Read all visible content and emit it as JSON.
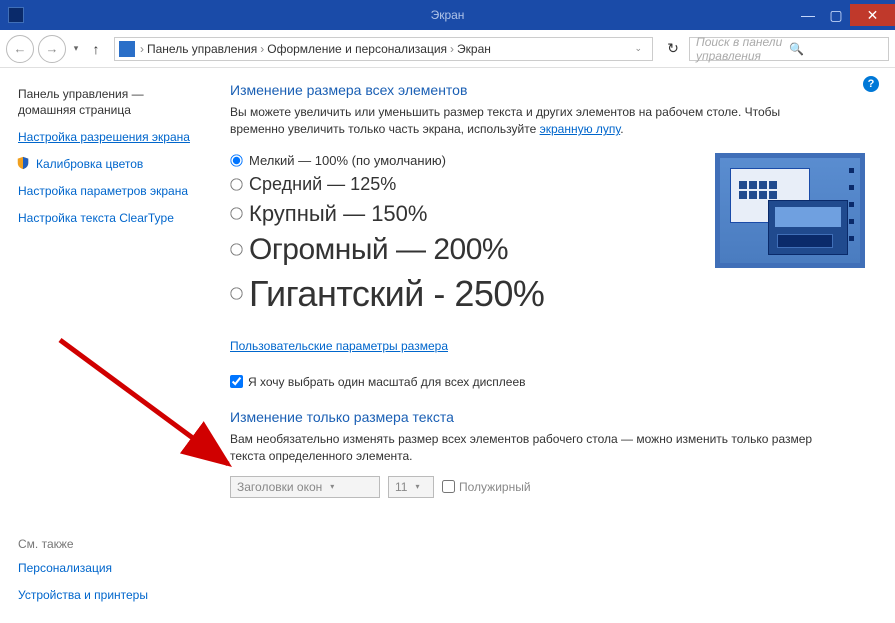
{
  "titlebar": {
    "title": "Экран"
  },
  "nav": {
    "breadcrumb": [
      "Панель управления",
      "Оформление и персонализация",
      "Экран"
    ],
    "search_placeholder": "Поиск в панели управления"
  },
  "sidebar": {
    "home_line1": "Панель управления —",
    "home_line2": "домашняя страница",
    "links": [
      "Настройка разрешения экрана",
      "Калибровка цветов",
      "Настройка параметров экрана",
      "Настройка текста ClearType"
    ],
    "see_also_title": "См. также",
    "see_also": [
      "Персонализация",
      "Устройства и принтеры"
    ]
  },
  "main": {
    "section1": {
      "heading": "Изменение размера всех элементов",
      "desc_before": "Вы можете увеличить или уменьшить размер текста и других элементов на рабочем столе. Чтобы временно увеличить только часть экрана, используйте ",
      "desc_link": "экранную лупу",
      "desc_after": "."
    },
    "radios": [
      {
        "label": "Мелкий — 100% (по умолчанию)",
        "checked": true,
        "class": "r-small"
      },
      {
        "label": "Средний — 125%",
        "checked": false,
        "class": "r-medium"
      },
      {
        "label": "Крупный — 150%",
        "checked": false,
        "class": "r-large"
      },
      {
        "label": "Огромный — 200%",
        "checked": false,
        "class": "r-huge"
      },
      {
        "label": "Гигантский - 250%",
        "checked": false,
        "class": "r-giant"
      }
    ],
    "custom_link": "Пользовательские параметры размера",
    "checkbox": {
      "label": "Я хочу выбрать один масштаб для всех дисплеев",
      "checked": true
    },
    "section2": {
      "heading": "Изменение только размера текста",
      "desc": "Вам необязательно изменять размер всех элементов рабочего стола — можно изменить только размер текста определенного элемента."
    },
    "combos": {
      "element": "Заголовки окон",
      "size": "11",
      "bold_label": "Полужирный"
    }
  }
}
